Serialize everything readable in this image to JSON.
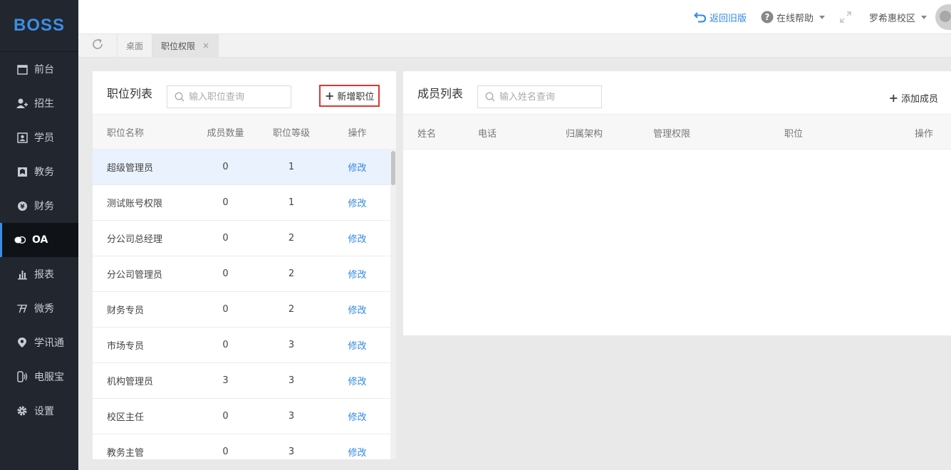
{
  "sidebar": {
    "logo": "BOSS",
    "items": [
      {
        "label": "前台",
        "icon": "calendar-icon"
      },
      {
        "label": "招生",
        "icon": "add-user-icon"
      },
      {
        "label": "学员",
        "icon": "student-card-icon"
      },
      {
        "label": "教务",
        "icon": "book-icon"
      },
      {
        "label": "财务",
        "icon": "yen-coin-icon"
      },
      {
        "label": "OA",
        "icon": "chat-bubbles-icon",
        "active": true
      },
      {
        "label": "报表",
        "icon": "bar-chart-icon"
      },
      {
        "label": "微秀",
        "icon": "weixiu-icon"
      },
      {
        "label": "学讯通",
        "icon": "location-pin-icon"
      },
      {
        "label": "电服宝",
        "icon": "phone-icon"
      },
      {
        "label": "设置",
        "icon": "gear-icon"
      }
    ]
  },
  "header": {
    "back_old": "返回旧版",
    "help": "在线帮助",
    "campus": "罗希惠校区"
  },
  "tabs": [
    {
      "label": "桌面"
    },
    {
      "label": "职位权限",
      "close": "×"
    }
  ],
  "positions": {
    "title": "职位列表",
    "search_placeholder": "输入职位查询",
    "add_label": "新增职位",
    "columns": {
      "name": "职位名称",
      "count": "成员数量",
      "level": "职位等级",
      "op": "操作"
    },
    "rows": [
      {
        "name": "超级管理员",
        "count": "0",
        "level": "1",
        "op": "修改"
      },
      {
        "name": "测试账号权限",
        "count": "0",
        "level": "1",
        "op": "修改"
      },
      {
        "name": "分公司总经理",
        "count": "0",
        "level": "2",
        "op": "修改"
      },
      {
        "name": "分公司管理员",
        "count": "0",
        "level": "2",
        "op": "修改"
      },
      {
        "name": "财务专员",
        "count": "0",
        "level": "2",
        "op": "修改"
      },
      {
        "name": "市场专员",
        "count": "0",
        "level": "3",
        "op": "修改"
      },
      {
        "name": "机构管理员",
        "count": "3",
        "level": "3",
        "op": "修改"
      },
      {
        "name": "校区主任",
        "count": "0",
        "level": "3",
        "op": "修改"
      },
      {
        "name": "教务主管",
        "count": "0",
        "level": "3",
        "op": "修改"
      }
    ]
  },
  "members": {
    "title": "成员列表",
    "search_placeholder": "输入姓名查询",
    "add_label": "添加成员",
    "columns": {
      "name": "姓名",
      "phone": "电话",
      "org": "归属架构",
      "perm": "管理权限",
      "position": "职位",
      "op": "操作"
    }
  },
  "colors": {
    "accent": "#2f88e6",
    "sidebar_bg": "#22262e",
    "highlight": "#e03535"
  }
}
